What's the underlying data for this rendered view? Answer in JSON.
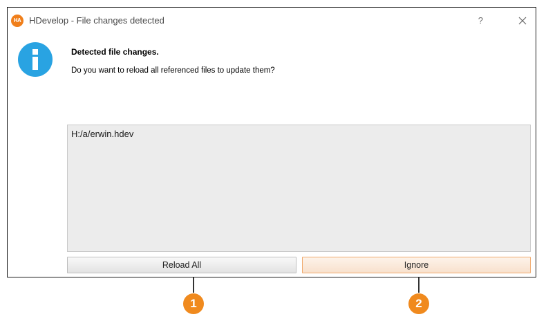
{
  "window": {
    "logo_text": "HA",
    "title": "HDevelop - File changes detected",
    "help_label": "?"
  },
  "dialog": {
    "icon": "info-icon",
    "heading": "Detected file changes.",
    "message": "Do you want to reload all referenced files to update them?",
    "files": [
      "H:/a/erwin.hdev"
    ],
    "buttons": {
      "reload_all": "Reload All",
      "ignore": "Ignore"
    }
  },
  "callouts": [
    "1",
    "2"
  ],
  "colors": {
    "accent": "#f08a1e",
    "info_blue": "#29a3e2",
    "list_bg": "#ececec"
  }
}
